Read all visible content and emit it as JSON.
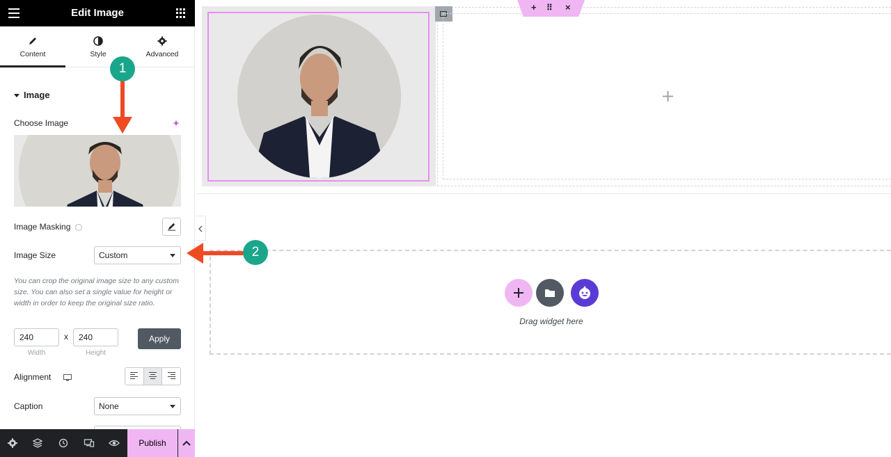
{
  "panel": {
    "title": "Edit Image",
    "tabs": [
      {
        "label": "Content",
        "icon": "pencil-icon"
      },
      {
        "label": "Style",
        "icon": "half-circle-icon"
      },
      {
        "label": "Advanced",
        "icon": "gear-icon"
      }
    ],
    "section_title": "Image",
    "choose_image_label": "Choose Image",
    "image_masking_label": "Image Masking",
    "image_size_label": "Image Size",
    "image_size_value": "Custom",
    "help_text": "You can crop the original image size to any custom size. You can also set a single value for height or width in order to keep the original size ratio.",
    "width_value": "240",
    "height_value": "240",
    "times_symbol": "x",
    "width_label": "Width",
    "height_label": "Height",
    "apply_label": "Apply",
    "alignment_label": "Alignment",
    "caption_label": "Caption",
    "caption_value": "None"
  },
  "bottom_bar": {
    "publish_label": "Publish",
    "icons": [
      "settings-icon",
      "layers-icon",
      "history-icon",
      "responsive-icon",
      "preview-icon"
    ]
  },
  "canvas": {
    "drag_text": "Drag widget here",
    "section_toolbar": [
      "+",
      "⠿",
      "×"
    ]
  },
  "annotations": {
    "badge1": "1",
    "badge2": "2"
  },
  "colors": {
    "accent_pink": "#f0b6f3",
    "arrow_red": "#f04a23",
    "badge_green": "#1aa68a",
    "dark_bar": "#000000"
  }
}
